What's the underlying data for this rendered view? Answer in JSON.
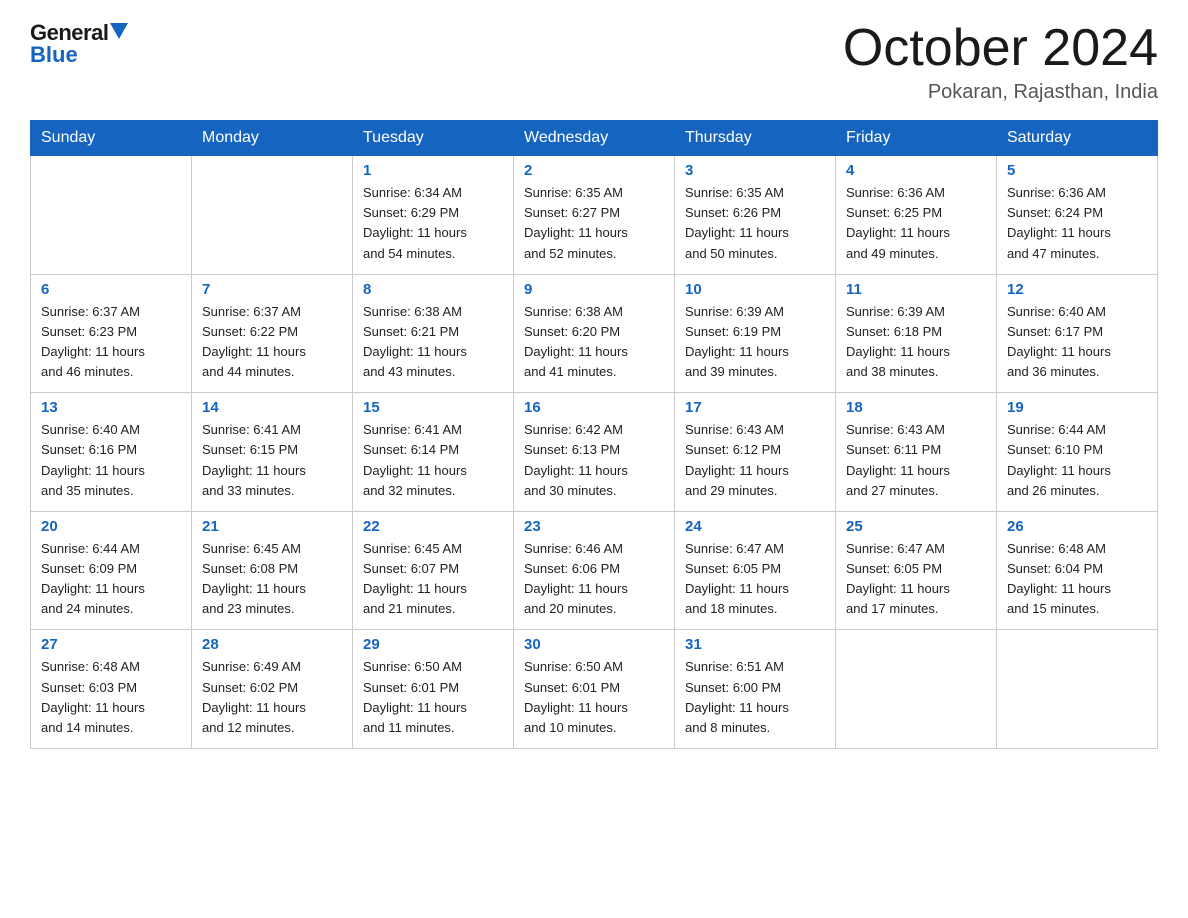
{
  "header": {
    "logo_general": "General",
    "logo_blue": "Blue",
    "title": "October 2024",
    "location": "Pokaran, Rajasthan, India"
  },
  "days_of_week": [
    "Sunday",
    "Monday",
    "Tuesday",
    "Wednesday",
    "Thursday",
    "Friday",
    "Saturday"
  ],
  "weeks": [
    [
      {
        "day": "",
        "info": ""
      },
      {
        "day": "",
        "info": ""
      },
      {
        "day": "1",
        "info": "Sunrise: 6:34 AM\nSunset: 6:29 PM\nDaylight: 11 hours\nand 54 minutes."
      },
      {
        "day": "2",
        "info": "Sunrise: 6:35 AM\nSunset: 6:27 PM\nDaylight: 11 hours\nand 52 minutes."
      },
      {
        "day": "3",
        "info": "Sunrise: 6:35 AM\nSunset: 6:26 PM\nDaylight: 11 hours\nand 50 minutes."
      },
      {
        "day": "4",
        "info": "Sunrise: 6:36 AM\nSunset: 6:25 PM\nDaylight: 11 hours\nand 49 minutes."
      },
      {
        "day": "5",
        "info": "Sunrise: 6:36 AM\nSunset: 6:24 PM\nDaylight: 11 hours\nand 47 minutes."
      }
    ],
    [
      {
        "day": "6",
        "info": "Sunrise: 6:37 AM\nSunset: 6:23 PM\nDaylight: 11 hours\nand 46 minutes."
      },
      {
        "day": "7",
        "info": "Sunrise: 6:37 AM\nSunset: 6:22 PM\nDaylight: 11 hours\nand 44 minutes."
      },
      {
        "day": "8",
        "info": "Sunrise: 6:38 AM\nSunset: 6:21 PM\nDaylight: 11 hours\nand 43 minutes."
      },
      {
        "day": "9",
        "info": "Sunrise: 6:38 AM\nSunset: 6:20 PM\nDaylight: 11 hours\nand 41 minutes."
      },
      {
        "day": "10",
        "info": "Sunrise: 6:39 AM\nSunset: 6:19 PM\nDaylight: 11 hours\nand 39 minutes."
      },
      {
        "day": "11",
        "info": "Sunrise: 6:39 AM\nSunset: 6:18 PM\nDaylight: 11 hours\nand 38 minutes."
      },
      {
        "day": "12",
        "info": "Sunrise: 6:40 AM\nSunset: 6:17 PM\nDaylight: 11 hours\nand 36 minutes."
      }
    ],
    [
      {
        "day": "13",
        "info": "Sunrise: 6:40 AM\nSunset: 6:16 PM\nDaylight: 11 hours\nand 35 minutes."
      },
      {
        "day": "14",
        "info": "Sunrise: 6:41 AM\nSunset: 6:15 PM\nDaylight: 11 hours\nand 33 minutes."
      },
      {
        "day": "15",
        "info": "Sunrise: 6:41 AM\nSunset: 6:14 PM\nDaylight: 11 hours\nand 32 minutes."
      },
      {
        "day": "16",
        "info": "Sunrise: 6:42 AM\nSunset: 6:13 PM\nDaylight: 11 hours\nand 30 minutes."
      },
      {
        "day": "17",
        "info": "Sunrise: 6:43 AM\nSunset: 6:12 PM\nDaylight: 11 hours\nand 29 minutes."
      },
      {
        "day": "18",
        "info": "Sunrise: 6:43 AM\nSunset: 6:11 PM\nDaylight: 11 hours\nand 27 minutes."
      },
      {
        "day": "19",
        "info": "Sunrise: 6:44 AM\nSunset: 6:10 PM\nDaylight: 11 hours\nand 26 minutes."
      }
    ],
    [
      {
        "day": "20",
        "info": "Sunrise: 6:44 AM\nSunset: 6:09 PM\nDaylight: 11 hours\nand 24 minutes."
      },
      {
        "day": "21",
        "info": "Sunrise: 6:45 AM\nSunset: 6:08 PM\nDaylight: 11 hours\nand 23 minutes."
      },
      {
        "day": "22",
        "info": "Sunrise: 6:45 AM\nSunset: 6:07 PM\nDaylight: 11 hours\nand 21 minutes."
      },
      {
        "day": "23",
        "info": "Sunrise: 6:46 AM\nSunset: 6:06 PM\nDaylight: 11 hours\nand 20 minutes."
      },
      {
        "day": "24",
        "info": "Sunrise: 6:47 AM\nSunset: 6:05 PM\nDaylight: 11 hours\nand 18 minutes."
      },
      {
        "day": "25",
        "info": "Sunrise: 6:47 AM\nSunset: 6:05 PM\nDaylight: 11 hours\nand 17 minutes."
      },
      {
        "day": "26",
        "info": "Sunrise: 6:48 AM\nSunset: 6:04 PM\nDaylight: 11 hours\nand 15 minutes."
      }
    ],
    [
      {
        "day": "27",
        "info": "Sunrise: 6:48 AM\nSunset: 6:03 PM\nDaylight: 11 hours\nand 14 minutes."
      },
      {
        "day": "28",
        "info": "Sunrise: 6:49 AM\nSunset: 6:02 PM\nDaylight: 11 hours\nand 12 minutes."
      },
      {
        "day": "29",
        "info": "Sunrise: 6:50 AM\nSunset: 6:01 PM\nDaylight: 11 hours\nand 11 minutes."
      },
      {
        "day": "30",
        "info": "Sunrise: 6:50 AM\nSunset: 6:01 PM\nDaylight: 11 hours\nand 10 minutes."
      },
      {
        "day": "31",
        "info": "Sunrise: 6:51 AM\nSunset: 6:00 PM\nDaylight: 11 hours\nand 8 minutes."
      },
      {
        "day": "",
        "info": ""
      },
      {
        "day": "",
        "info": ""
      }
    ]
  ]
}
